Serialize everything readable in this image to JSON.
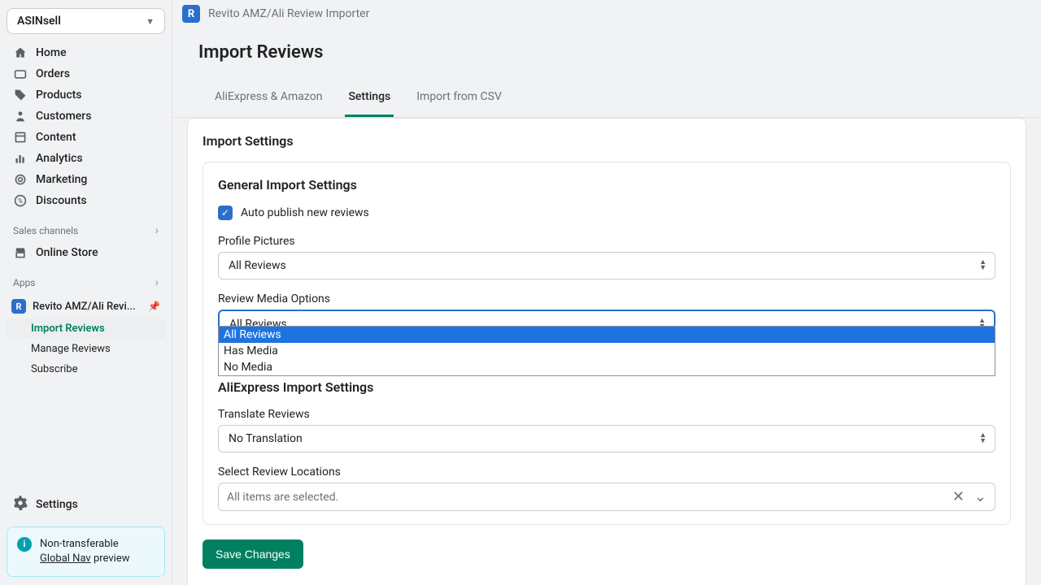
{
  "sidebar": {
    "store": "ASINsell",
    "nav": [
      {
        "label": "Home",
        "icon": "⌂"
      },
      {
        "label": "Orders",
        "icon": "▭"
      },
      {
        "label": "Products",
        "icon": "🏷"
      },
      {
        "label": "Customers",
        "icon": "👤"
      },
      {
        "label": "Content",
        "icon": "▤"
      },
      {
        "label": "Analytics",
        "icon": "📊"
      },
      {
        "label": "Marketing",
        "icon": "◎"
      },
      {
        "label": "Discounts",
        "icon": "%"
      }
    ],
    "sales_channels_label": "Sales channels",
    "online_store": "Online Store",
    "apps_label": "Apps",
    "app_name": "Revito AMZ/Ali Revi...",
    "sub_items": [
      "Import Reviews",
      "Manage Reviews",
      "Subscribe"
    ],
    "settings": "Settings",
    "info_line1": "Non-transferable",
    "info_link": "Global Nav",
    "info_line2": " preview"
  },
  "topbar": {
    "app_title": "Revito AMZ/Ali Review Importer"
  },
  "page": {
    "title": "Import Reviews",
    "tabs": [
      "AliExpress & Amazon",
      "Settings",
      "Import from CSV"
    ],
    "section_title": "Import Settings",
    "general": {
      "title": "General Import Settings",
      "checkbox_label": "Auto publish new reviews",
      "profile_label": "Profile Pictures",
      "profile_value": "All Reviews",
      "media_label": "Review Media Options",
      "media_value": "All Reviews",
      "media_options": [
        "All Reviews",
        "Has Media",
        "No Media"
      ]
    },
    "aliexpress": {
      "title": "AliExpress Import Settings",
      "translate_label": "Translate Reviews",
      "translate_value": "No Translation",
      "locations_label": "Select Review Locations",
      "locations_value": "All items are selected."
    },
    "save_label": "Save Changes"
  }
}
